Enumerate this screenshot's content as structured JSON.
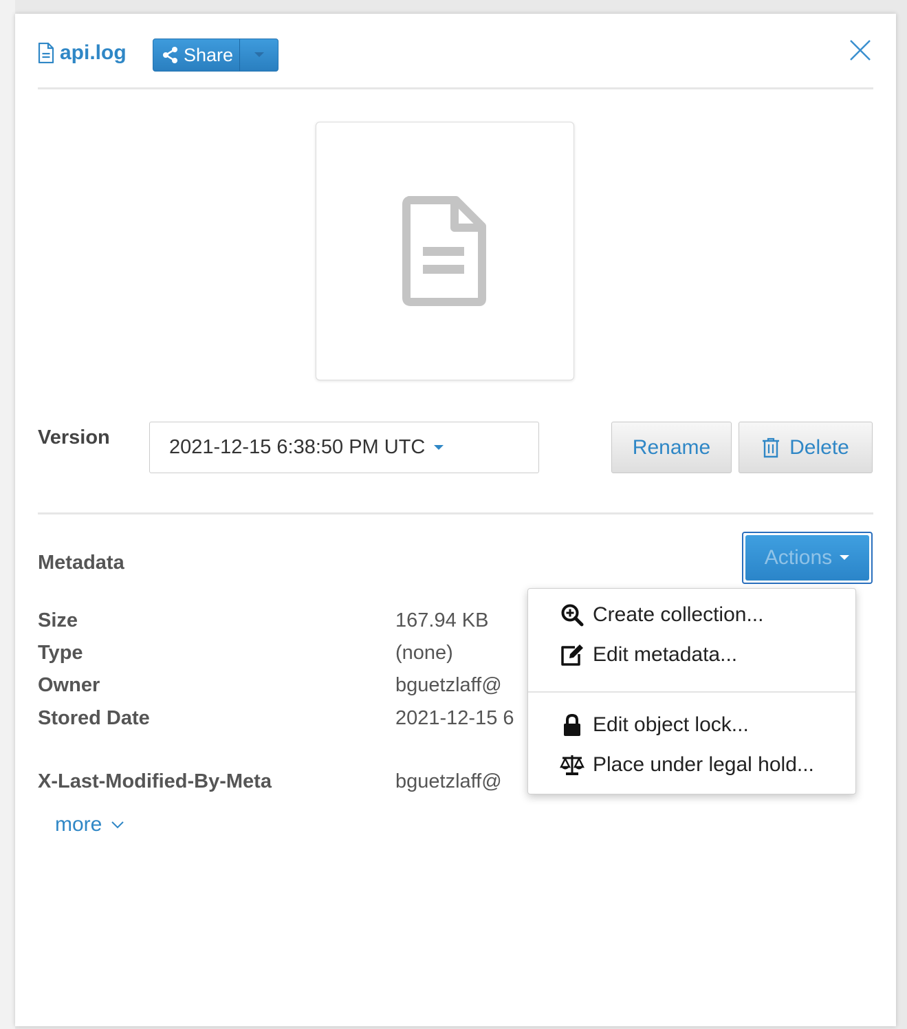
{
  "file": {
    "name": "api.log"
  },
  "share": {
    "label": "Share"
  },
  "version": {
    "label": "Version",
    "selected": "2021-12-15 6:38:50 PM UTC"
  },
  "buttons": {
    "rename": "Rename",
    "delete": "Delete",
    "actions": "Actions"
  },
  "metadata": {
    "title": "Metadata",
    "rows": [
      {
        "key": "Size",
        "value": "167.94 KB"
      },
      {
        "key": "Type",
        "value": "(none)"
      },
      {
        "key": "Owner",
        "value": "bguetzlaff@"
      },
      {
        "key": "Stored Date",
        "value": "2021-12-15 6"
      },
      {
        "key": "X-Last-Modified-By-Meta",
        "value": "bguetzlaff@"
      }
    ],
    "more": "more"
  },
  "actions_menu": {
    "items": [
      {
        "label": "Create collection...",
        "icon": "zoom-in-icon"
      },
      {
        "label": "Edit metadata...",
        "icon": "edit-icon"
      },
      {
        "label": "Edit object lock...",
        "icon": "lock-icon"
      },
      {
        "label": "Place under legal hold...",
        "icon": "scale-icon"
      }
    ]
  },
  "colors": {
    "accent": "#2f87c6",
    "share_bg": "#3e9bdc",
    "text": "#555555"
  }
}
